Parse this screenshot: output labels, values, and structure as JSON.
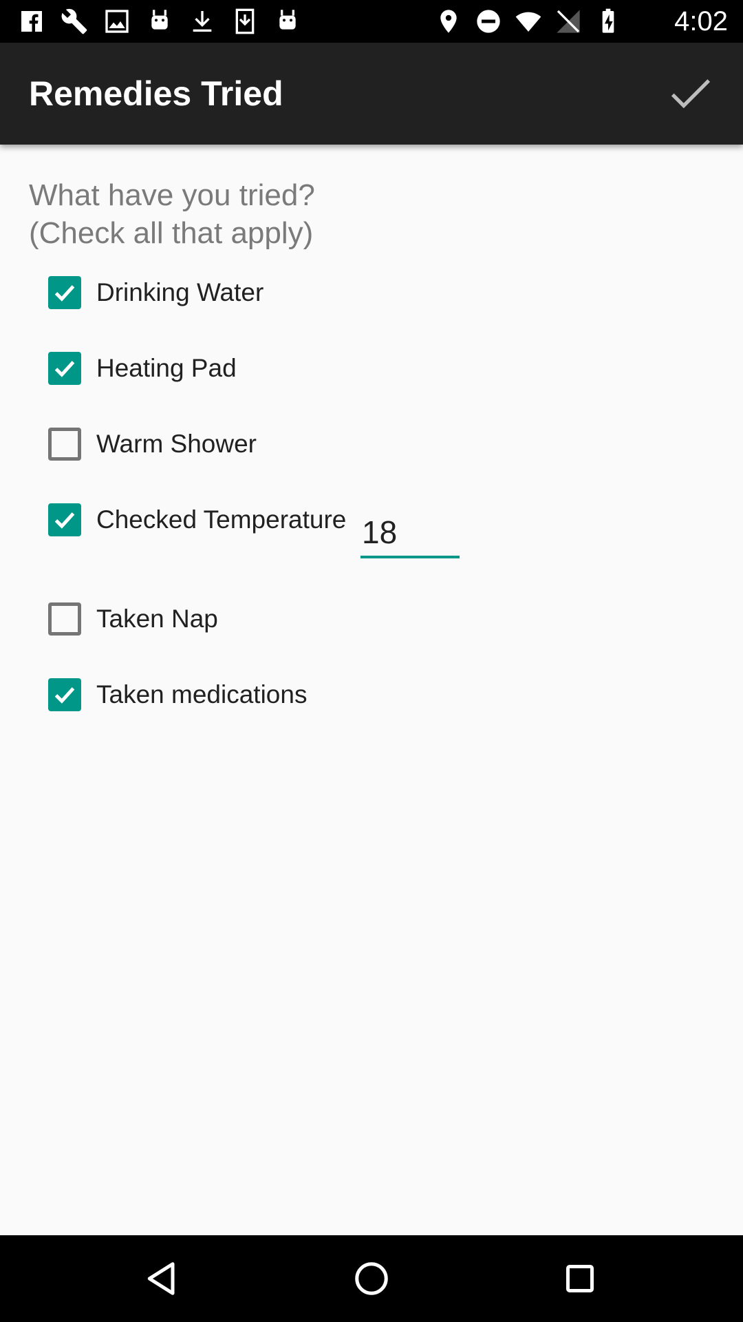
{
  "status_bar": {
    "time": "4:02",
    "left_icons": [
      "facebook-icon",
      "wrench-icon",
      "image-icon",
      "android-icon",
      "download-icon",
      "download-box-icon",
      "android-icon"
    ],
    "right_icons": [
      "location-icon",
      "do-not-disturb-icon",
      "wifi-icon",
      "no-signal-icon",
      "battery-charging-icon"
    ]
  },
  "toolbar": {
    "title": "Remedies Tried",
    "done_icon": "check-icon"
  },
  "prompt": {
    "line1": "What have you tried?",
    "line2": "(Check all that apply)"
  },
  "remedies": [
    {
      "label": "Drinking Water",
      "checked": true
    },
    {
      "label": "Heating Pad",
      "checked": true
    },
    {
      "label": "Warm Shower",
      "checked": false
    },
    {
      "label": "Checked Temperature",
      "checked": true
    },
    {
      "label": "Taken Nap",
      "checked": false
    },
    {
      "label": "Taken medications",
      "checked": true
    }
  ],
  "temperature_input": {
    "value": "18"
  },
  "colors": {
    "accent": "#009688",
    "toolbar": "#212121",
    "background": "#fafafa"
  },
  "nav_bar": {
    "icons": [
      "back-icon",
      "home-icon",
      "recents-icon"
    ]
  }
}
